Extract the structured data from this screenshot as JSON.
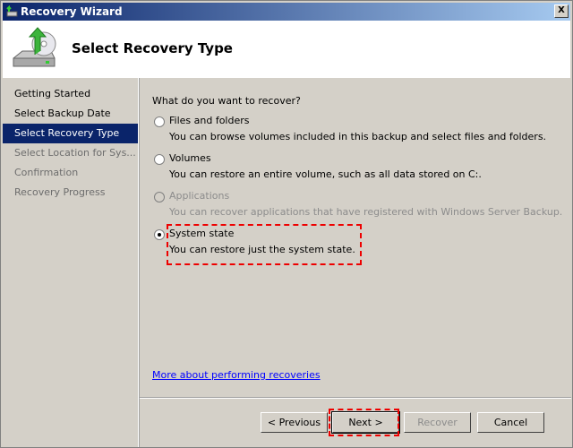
{
  "window": {
    "title": "Recovery Wizard",
    "close_label": "X"
  },
  "header": {
    "title": "Select Recovery Type"
  },
  "nav": {
    "items": [
      {
        "label": "Getting Started",
        "state": "normal"
      },
      {
        "label": "Select Backup Date",
        "state": "normal"
      },
      {
        "label": "Select Recovery Type",
        "state": "selected"
      },
      {
        "label": "Select Location for Sys...",
        "state": "disabled"
      },
      {
        "label": "Confirmation",
        "state": "disabled"
      },
      {
        "label": "Recovery Progress",
        "state": "disabled"
      }
    ]
  },
  "content": {
    "question": "What do you want to recover?",
    "options": [
      {
        "label": "Files and folders",
        "description": "You can browse volumes included in this backup and select files and folders.",
        "selected": false,
        "enabled": true
      },
      {
        "label": "Volumes",
        "description": "You can restore an entire volume, such as all data stored on C:.",
        "selected": false,
        "enabled": true
      },
      {
        "label": "Applications",
        "description": "You can recover applications that have registered with Windows Server Backup.",
        "selected": false,
        "enabled": false
      },
      {
        "label": "System state",
        "description": "You can restore just the system state.",
        "selected": true,
        "enabled": true
      }
    ],
    "help_link": "More about performing recoveries"
  },
  "buttons": {
    "previous": "< Previous",
    "next": "Next >",
    "recover": "Recover",
    "cancel": "Cancel"
  },
  "colors": {
    "highlight": "#ee0000",
    "selection": "#0a246a"
  }
}
